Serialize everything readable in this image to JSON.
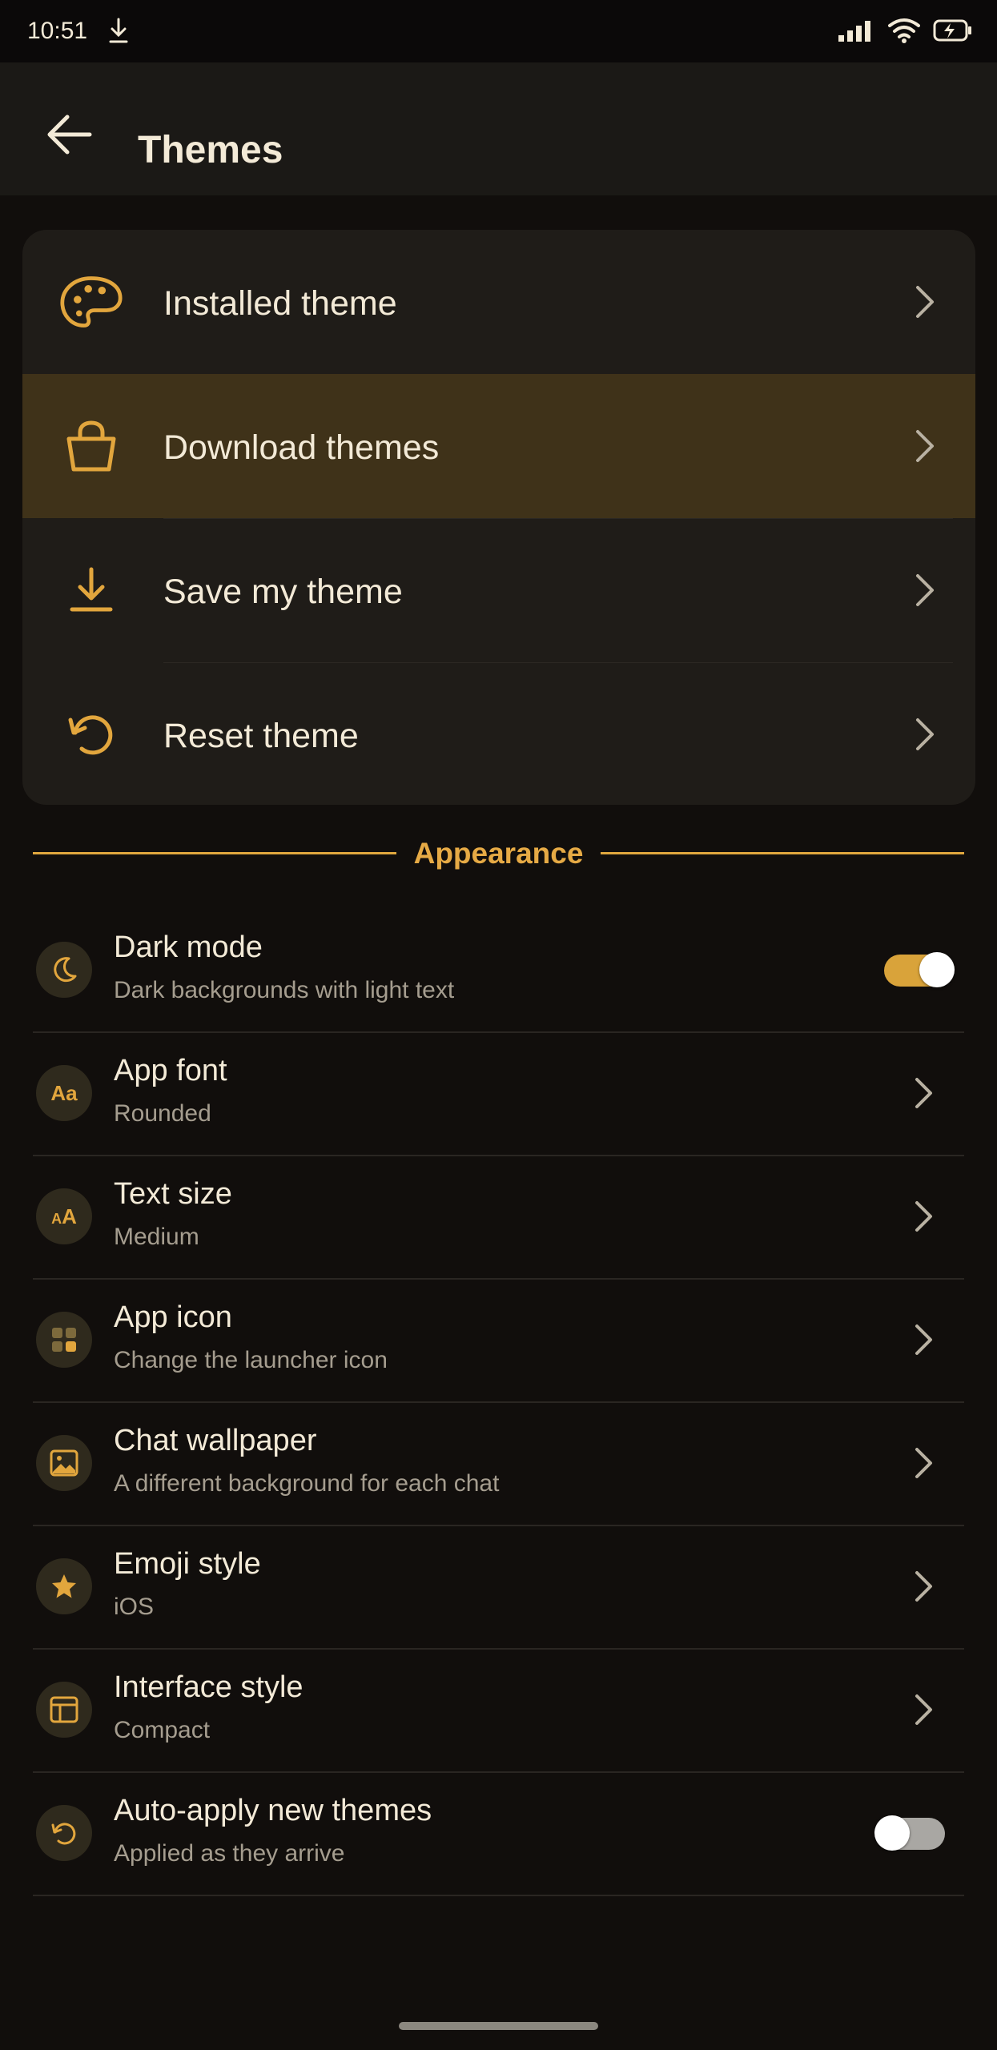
{
  "status_bar": {
    "time": "10:51"
  },
  "app_bar": {
    "title": "Themes"
  },
  "theme_menu": [
    {
      "label": "Installed theme",
      "icon": "palette-icon"
    },
    {
      "label": "Download themes",
      "icon": "shopping-bag-icon",
      "highlighted": true
    },
    {
      "label": "Save my theme",
      "icon": "download-icon"
    },
    {
      "label": "Reset theme",
      "icon": "reset-icon"
    }
  ],
  "section": {
    "title": "Appearance"
  },
  "settings": [
    {
      "title": "Dark mode",
      "subtitle": "Dark backgrounds with light text",
      "icon": "moon-icon",
      "control": "toggle",
      "enabled": true
    },
    {
      "title": "App font",
      "subtitle": "Rounded",
      "icon": "font-icon",
      "icon_text": "Aa",
      "control": "chevron"
    },
    {
      "title": "Text size",
      "subtitle": "Medium",
      "icon": "text-size-icon",
      "icon_text": "AA",
      "control": "chevron"
    },
    {
      "title": "App icon",
      "subtitle": "Change the launcher icon",
      "icon": "grid-icon",
      "control": "chevron"
    },
    {
      "title": "Chat wallpaper",
      "subtitle": "A different background for each chat",
      "icon": "image-icon",
      "control": "chevron"
    },
    {
      "title": "Emoji style",
      "subtitle": "iOS",
      "icon": "star-icon",
      "control": "chevron"
    },
    {
      "title": "Interface style",
      "subtitle": "Compact",
      "icon": "layout-icon",
      "control": "chevron"
    },
    {
      "title": "Auto-apply new themes",
      "subtitle": "Applied as they arrive",
      "icon": "refresh-icon",
      "control": "toggle",
      "enabled": false
    }
  ],
  "colors": {
    "accent": "#e0a73e",
    "background": "#110e0c",
    "card": "#1f1c18",
    "highlight": "#3f3219"
  }
}
